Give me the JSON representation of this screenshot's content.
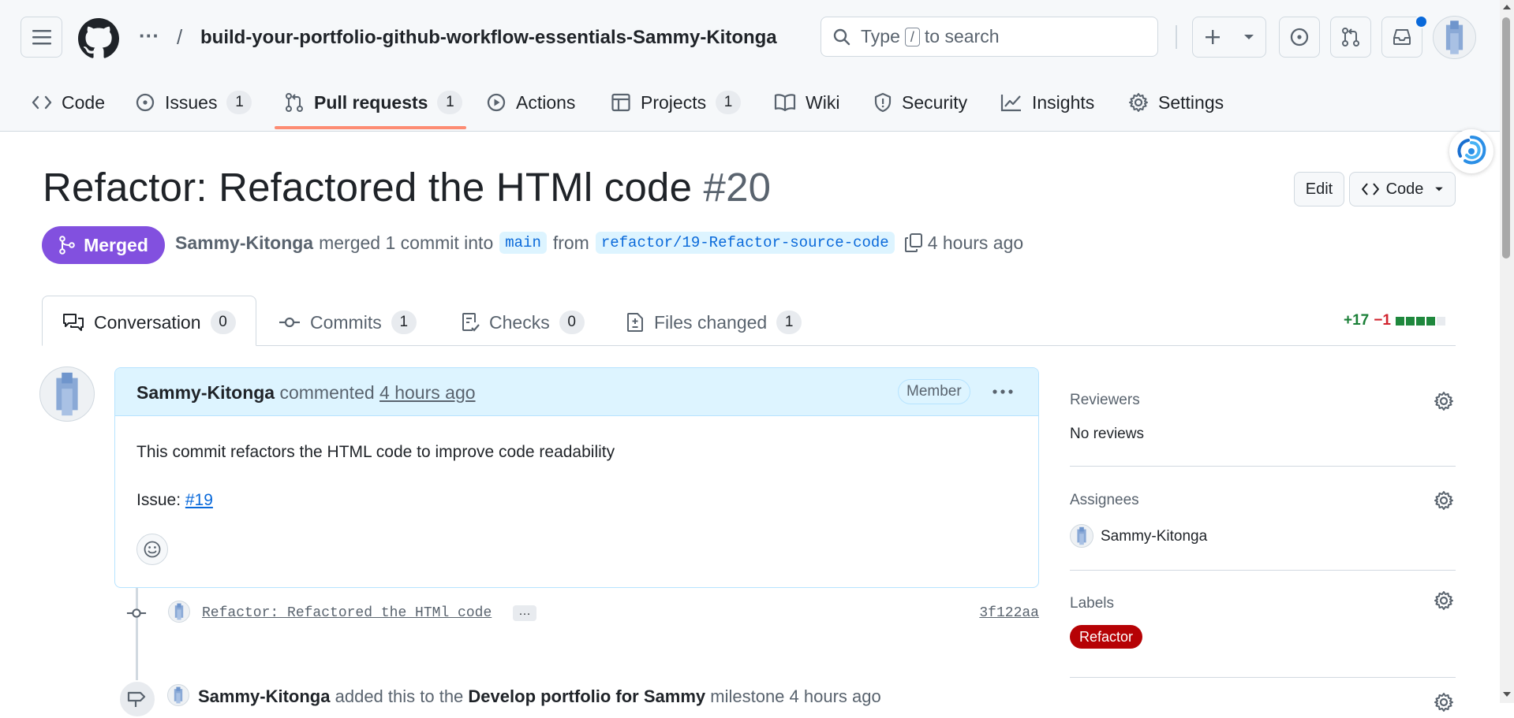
{
  "header": {
    "repo_name": "build-your-portfolio-github-workflow-essentials-Sammy-Kitonga",
    "breadcrumb_sep": "/",
    "more": "···",
    "search": {
      "prefix": "Type",
      "key": "/",
      "suffix": "to search"
    }
  },
  "nav": {
    "code": "Code",
    "issues": "Issues",
    "issues_count": "1",
    "pulls": "Pull requests",
    "pulls_count": "1",
    "actions": "Actions",
    "projects": "Projects",
    "projects_count": "1",
    "wiki": "Wiki",
    "security": "Security",
    "insights": "Insights",
    "settings": "Settings"
  },
  "pr": {
    "title": "Refactor: Refactored the HTMl code",
    "number": "#20",
    "edit": "Edit",
    "code_btn": "Code",
    "state": "Merged",
    "author": "Sammy-Kitonga",
    "merged_text": "merged 1 commit into",
    "base": "main",
    "from": "from",
    "head": "refactor/19-Refactor-source-code",
    "time": "4 hours ago"
  },
  "tabs": {
    "conversation": "Conversation",
    "conversation_count": "0",
    "commits": "Commits",
    "commits_count": "1",
    "checks": "Checks",
    "checks_count": "0",
    "files": "Files changed",
    "files_count": "1",
    "additions": "+17",
    "deletions": "−1"
  },
  "comment": {
    "author": "Sammy-Kitonga",
    "action": "commented",
    "time": "4 hours ago",
    "role": "Member",
    "body": "This commit refactors the HTML code to improve code readability",
    "issue_label": "Issue:",
    "issue_ref": "#19"
  },
  "commit": {
    "message": "Refactor: Refactored the HTMl code",
    "more": "···",
    "sha": "3f122aa"
  },
  "event": {
    "actor": "Sammy-Kitonga",
    "text1": "added this to the",
    "milestone": "Develop portfolio for Sammy",
    "text2": "milestone",
    "time": "4 hours ago"
  },
  "sidebar": {
    "reviewers_h": "Reviewers",
    "reviewers_v": "No reviews",
    "assignees_h": "Assignees",
    "assignee": "Sammy-Kitonga",
    "labels_h": "Labels",
    "label": "Refactor"
  },
  "colors": {
    "merged": "#8250df",
    "accent": "#0969da",
    "label_refactor": "#b60205",
    "underline": "#fd8c73"
  }
}
